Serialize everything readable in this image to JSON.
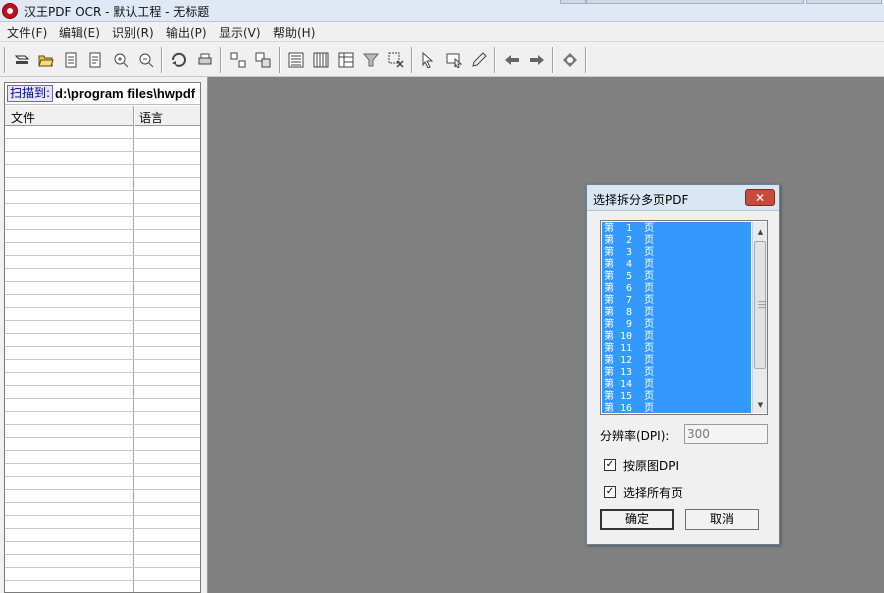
{
  "window": {
    "title": "汉王PDF OCR - 默认工程 - 无标题"
  },
  "menu": [
    {
      "label": "文件(F)"
    },
    {
      "label": "编辑(E)"
    },
    {
      "label": "识别(R)"
    },
    {
      "label": "输出(P)"
    },
    {
      "label": "显示(V)"
    },
    {
      "label": "帮助(H)"
    }
  ],
  "toolbar": {
    "icons": [
      "scan-icon",
      "open-folder-icon",
      "import-icon",
      "export-icon",
      "zoom-in-icon",
      "zoom-out-icon",
      "rotate-icon",
      "print-icon",
      "layout-icon",
      "layout2-icon",
      "text-block-icon",
      "table-block-icon",
      "image-block-icon",
      "filter-icon",
      "delete-block-icon",
      "pointer-icon",
      "select-region-icon",
      "pen-icon",
      "arrow-left-icon",
      "arrow-right-icon",
      "recognize-icon"
    ]
  },
  "left_panel": {
    "scan_label": "扫描到:",
    "scan_path": "d:\\program files\\hwpdf",
    "columns": [
      "文件",
      "语言"
    ]
  },
  "dialog": {
    "title": "选择拆分多页PDF",
    "close_label": "✕",
    "pages": [
      "第  1  页",
      "第  2  页",
      "第  3  页",
      "第  4  页",
      "第  5  页",
      "第  6  页",
      "第  7  页",
      "第  8  页",
      "第  9  页",
      "第 10  页",
      "第 11  页",
      "第 12  页",
      "第 13  页",
      "第 14  页",
      "第 15  页",
      "第 16  页"
    ],
    "dpi_label": "分辨率(DPI):",
    "dpi_value": "300",
    "use_original_dpi": {
      "label": "按原图DPI",
      "checked": true
    },
    "select_all_pages": {
      "label": "选择所有页",
      "checked": true
    },
    "ok_label": "确定",
    "cancel_label": "取消"
  }
}
